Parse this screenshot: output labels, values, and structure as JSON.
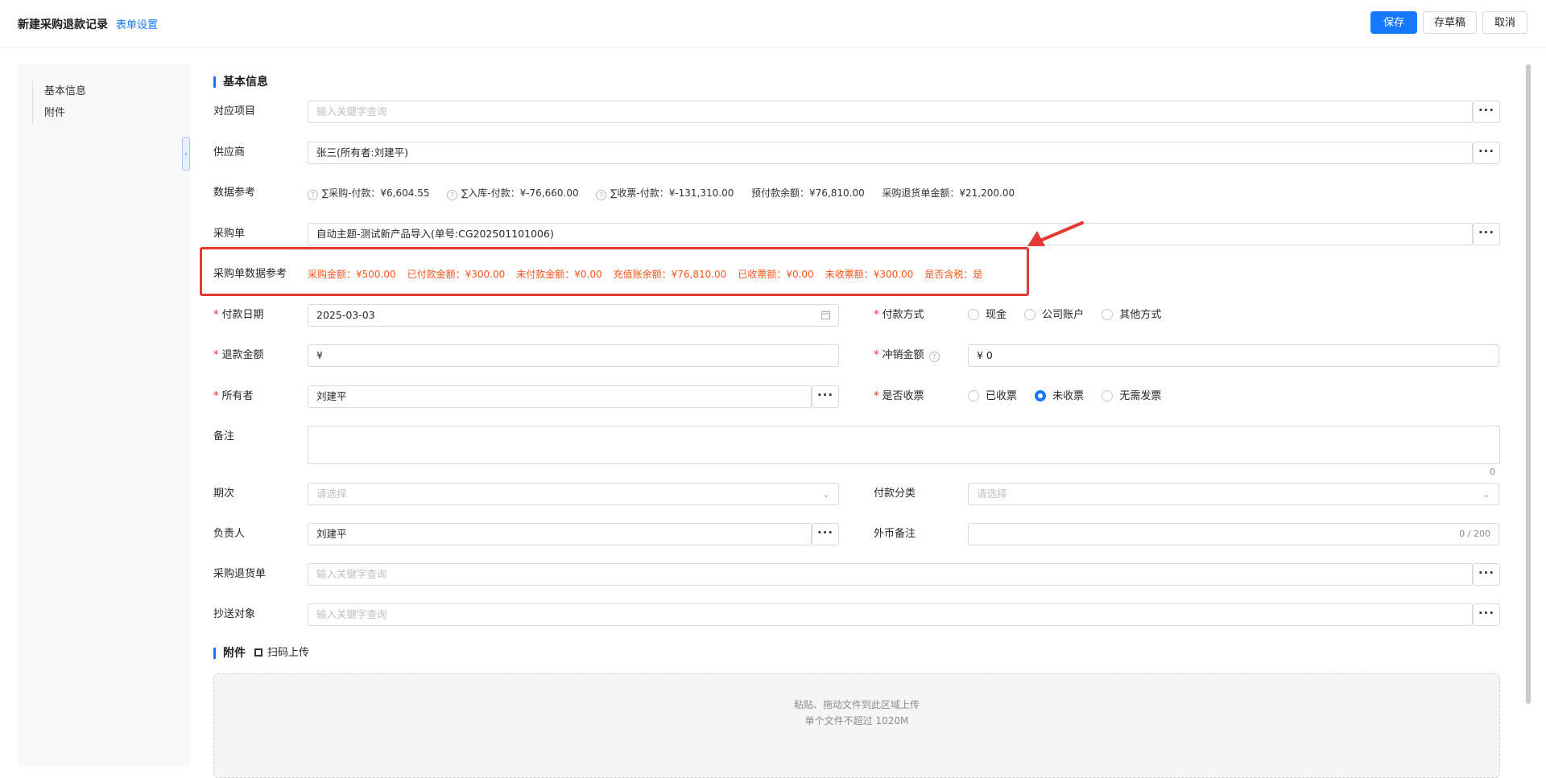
{
  "header": {
    "title": "新建采购退款记录",
    "form_settings": "表单设置",
    "save": "保存",
    "draft": "存草稿",
    "cancel": "取消"
  },
  "sidebar": {
    "items": [
      "基本信息",
      "附件"
    ]
  },
  "basic": {
    "section_title": "基本信息",
    "project": {
      "label": "对应项目",
      "placeholder": "输入关键字查询"
    },
    "supplier": {
      "label": "供应商",
      "value": "张三(所有者:刘建平)"
    },
    "data_ref": {
      "label": "数据参考",
      "purchase_payment": "∑采购-付款：¥6,604.55",
      "stock_payment": "∑入库-付款：¥-76,660.00",
      "invoice_payment": "∑收票-付款：¥-131,310.00",
      "prepaid_balance": "预付款余额：¥76,810.00",
      "return_amount": "采购退货单金额：¥21,200.00"
    },
    "po": {
      "label": "采购单",
      "value": "自动主题-测试新产品导入(单号:CG202501101006)"
    },
    "po_ref": {
      "label": "采购单数据参考",
      "items": [
        "采购金额：¥500.00",
        "已付款金额：¥300.00",
        "未付款金额：¥0.00",
        "充值账余额：¥76,810.00",
        "已收票额：¥0.00",
        "未收票额：¥300.00",
        "是否含税：是"
      ]
    },
    "pay_date": {
      "label": "付款日期",
      "value": "2025-03-03"
    },
    "pay_method": {
      "label": "付款方式",
      "options": [
        "现金",
        "公司账户",
        "其他方式"
      ],
      "selected": ""
    },
    "refund_amount": {
      "label": "退款金额",
      "value": "¥"
    },
    "writeoff": {
      "label": "冲销金额",
      "value": "¥ 0"
    },
    "owner": {
      "label": "所有者",
      "value": "刘建平"
    },
    "invoice": {
      "label": "是否收票",
      "options": [
        "已收票",
        "未收票",
        "无需发票"
      ],
      "selected": "未收票"
    },
    "remark": {
      "label": "备注",
      "count": "0"
    },
    "period": {
      "label": "期次",
      "placeholder": "请选择"
    },
    "pay_category": {
      "label": "付款分类",
      "placeholder": "请选择"
    },
    "person": {
      "label": "负责人",
      "value": "刘建平"
    },
    "fx_remark": {
      "label": "外币备注",
      "count": "0 / 200"
    },
    "return_order": {
      "label": "采购退货单",
      "placeholder": "输入关键字查询"
    },
    "cc": {
      "label": "抄送对象",
      "placeholder": "输入关键字查询"
    }
  },
  "attachments": {
    "section_title": "附件",
    "scan_upload": "扫码上传",
    "drop_text": "粘贴、拖动文件到此区域上传",
    "limit_text": "单个文件不超过 1020M"
  },
  "colors": {
    "primary": "#1677ff",
    "highlight": "#fa541c",
    "annotation": "#e53935"
  },
  "icons": [
    "calendar-icon",
    "chevron-down-icon",
    "help-icon",
    "qrcode-icon",
    "more-icon",
    "collapse-icon"
  ]
}
